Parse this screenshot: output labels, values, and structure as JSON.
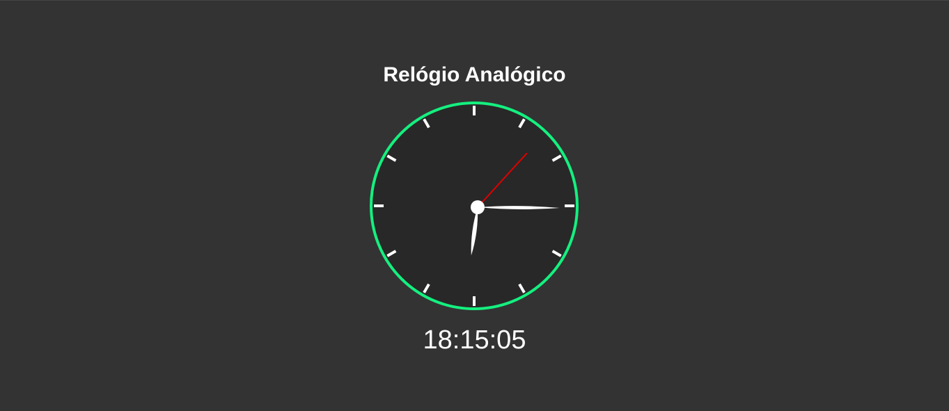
{
  "page": {
    "title": "Relógio Analógico",
    "digital_time": "18:15:05"
  },
  "clock": {
    "hours": 18,
    "minutes": 15,
    "seconds": 5,
    "tick_count": 12,
    "colors": {
      "background": "#333333",
      "face": "#282828",
      "rim": "#14f07f",
      "ticks": "#ffffff",
      "hands": "#ffffff",
      "second_hand": "#e00000"
    }
  }
}
